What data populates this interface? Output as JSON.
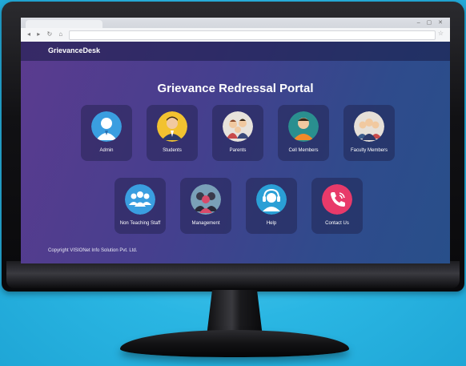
{
  "app": {
    "brand": "GrievanceDesk",
    "title": "Grievance Redressal Portal",
    "footer": "Copyright VISIONet Info Solution Pvt. Ltd."
  },
  "tiles_row1": [
    {
      "label": "Admin",
      "icon": "admin-avatar-icon",
      "color": "#3a9ee0"
    },
    {
      "label": "Students",
      "icon": "students-avatar-icon",
      "color": "#f2c230"
    },
    {
      "label": "Parents",
      "icon": "parents-avatar-icon",
      "color": "#e7e3dc"
    },
    {
      "label": "Cell Members",
      "icon": "cell-members-avatar-icon",
      "color": "#2a8f8f"
    },
    {
      "label": "Faculty Members",
      "icon": "faculty-members-avatar-icon",
      "color": "#e6e0d8"
    }
  ],
  "tiles_row2": [
    {
      "label": "Non Teaching Staff",
      "icon": "staff-group-icon",
      "color": "#3a9ee0"
    },
    {
      "label": "Management",
      "icon": "management-group-icon",
      "color": "#7aa0b8"
    },
    {
      "label": "Help",
      "icon": "headset-icon",
      "color": "#2a9fd6"
    },
    {
      "label": "Contact Us",
      "icon": "phone-icon",
      "color": "#e83a6a"
    }
  ]
}
